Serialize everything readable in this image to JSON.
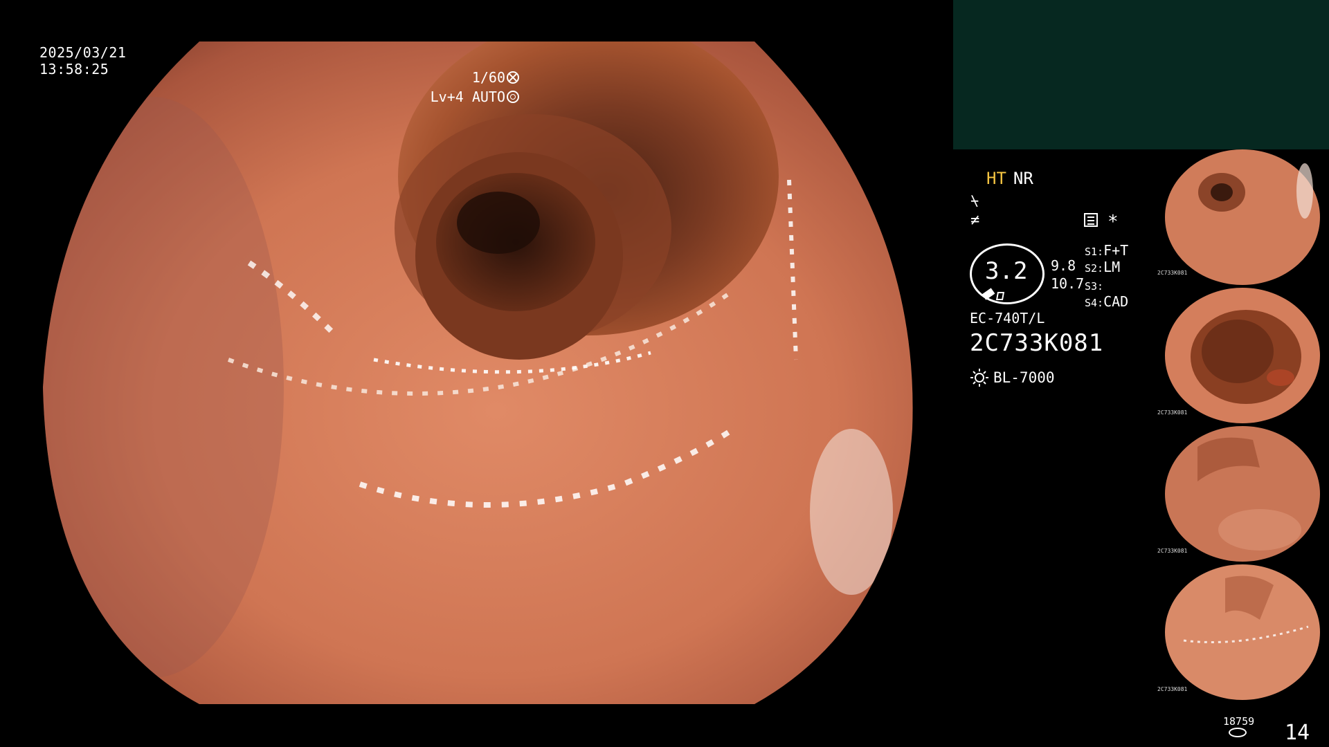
{
  "overlay": {
    "date": "2025/03/21",
    "time": "13:58:25",
    "shutter": "1/60",
    "agc": "Lv+4 AUTO"
  },
  "panel": {
    "mode_ht": "HT",
    "mode_nr": "NR",
    "icon_a": "⍀",
    "icon_b": "≠",
    "asterisk": "*",
    "zoom_value": "3.2",
    "value_a": "9.8",
    "value_b": "10.7",
    "s1_key": "S1:",
    "s1_val": "F+T",
    "s2_key": "S2:",
    "s2_val": "LM",
    "s3_key": "S3:",
    "s3_val": "",
    "s4_key": "S4:",
    "s4_val": "CAD",
    "scope_model": "EC-740T/L",
    "scope_serial": "2C733K081",
    "light_source": "BL-7000"
  },
  "thumbnails": [
    {
      "caption_left": "2C733K081",
      "caption_right": ""
    },
    {
      "caption_left": "2C733K081",
      "caption_right": ""
    },
    {
      "caption_left": "2C733K081",
      "caption_right": ""
    },
    {
      "caption_left": "2C733K081",
      "caption_right": ""
    }
  ],
  "footer": {
    "counter_small": "18759",
    "counter_big": "14"
  },
  "colors": {
    "ht_label": "#f5c542",
    "top_box": "#062820",
    "mucosa": "#c9704f"
  },
  "icons": {
    "shutter": "aperture-icon",
    "agc": "auto-ring-icon",
    "light": "sun-icon",
    "record": "disk-icon"
  }
}
